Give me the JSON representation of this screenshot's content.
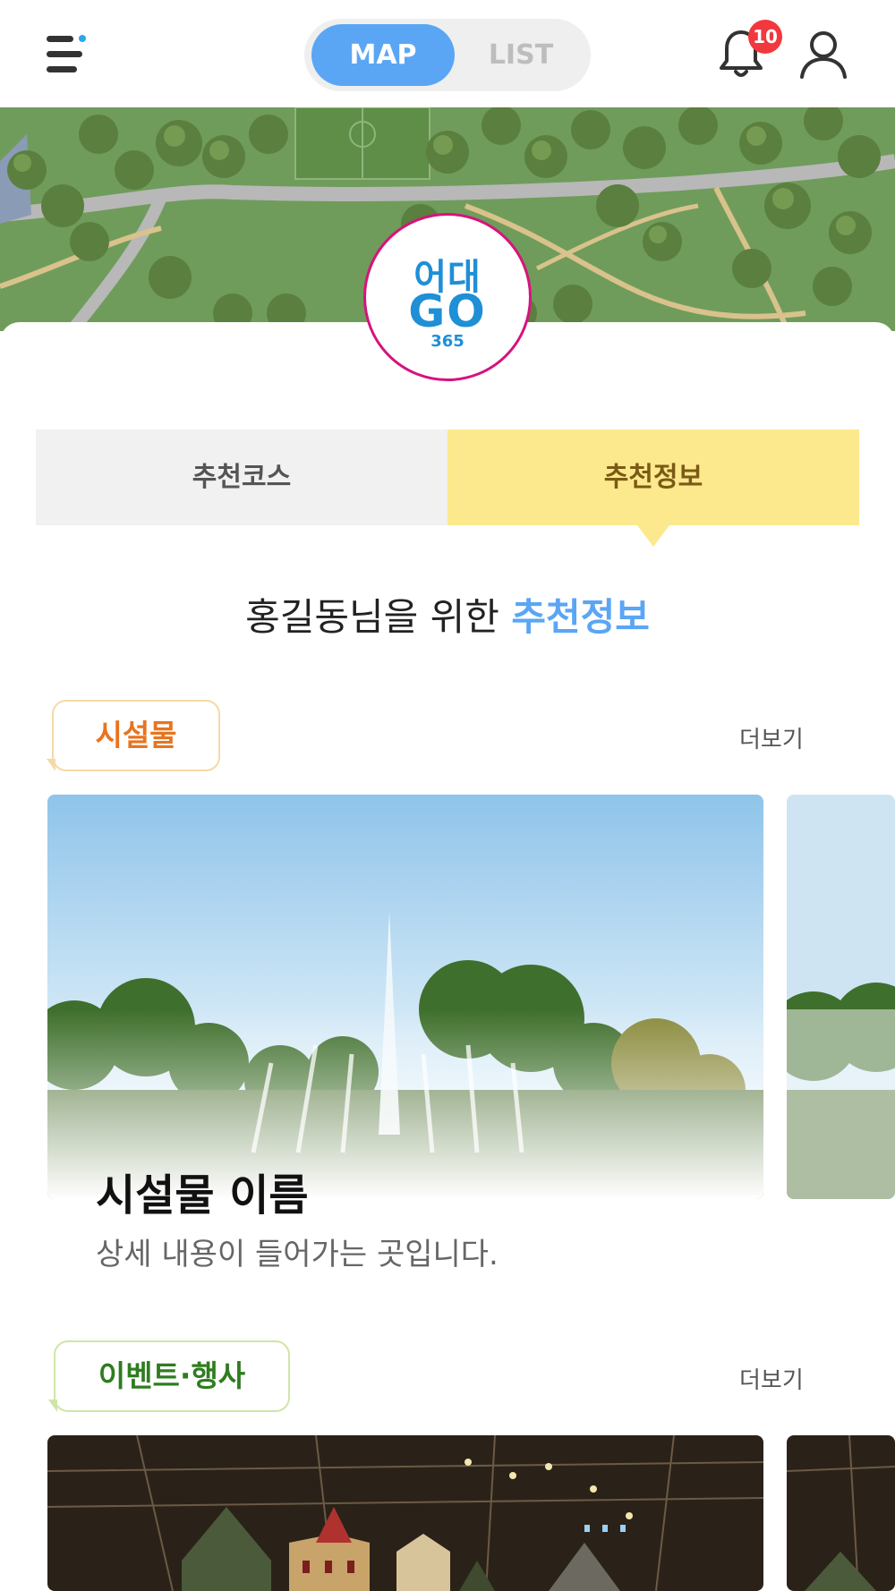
{
  "header": {
    "toggle_map": "MAP",
    "toggle_list": "LIST",
    "notification_count": "10"
  },
  "logo": {
    "line1": "어대",
    "line2": "GO",
    "line3": "365"
  },
  "tabs": [
    {
      "label": "추천코스",
      "active": false
    },
    {
      "label": "추천정보",
      "active": true
    }
  ],
  "greeting": {
    "prefix": "홍길동님을 위한",
    "highlight": "추천정보"
  },
  "sections": [
    {
      "tag": "시설물",
      "tag_color": "#e8741e",
      "tag_border": "#f5d9a8",
      "more": "더보기",
      "card": {
        "title": "시설물 이름",
        "desc": "상세 내용이 들어가는 곳입니다."
      }
    },
    {
      "tag": "이벤트·행사",
      "tag_color": "#2e7d1f",
      "tag_border": "#cfe5a8",
      "more": "더보기"
    }
  ],
  "colors": {
    "accent_blue": "#5aa6f5",
    "tab_active_bg": "#fce98e",
    "badge_red": "#f0383e",
    "logo_pink": "#d6137d"
  },
  "icons": [
    "menu-icon",
    "bell-icon",
    "user-icon"
  ]
}
